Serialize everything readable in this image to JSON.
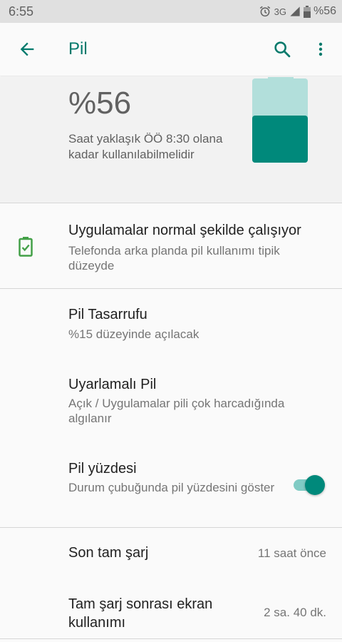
{
  "status_bar": {
    "time": "6:55",
    "network": "3G",
    "battery_text": "%56",
    "icons": [
      "alarm-icon",
      "signal-icon",
      "battery-icon"
    ]
  },
  "app_bar": {
    "title": "Pil",
    "icons": [
      "back-arrow-icon",
      "search-icon",
      "more-vert-icon"
    ]
  },
  "battery_header": {
    "percent": "%56",
    "estimate": "Saat yaklaşık ÖÖ 8:30 olana kadar kullanılabilmelidir",
    "level": 0.56
  },
  "tip": {
    "title": "Uygulamalar normal şekilde çalışıyor",
    "subtitle": "Telefonda arka planda pil kullanımı tipik düzeyde",
    "icon": "battery-ok-icon"
  },
  "settings": [
    {
      "title": "Pil Tasarrufu",
      "subtitle": "%15 düzeyinde açılacak"
    },
    {
      "title": "Uyarlamalı Pil",
      "subtitle": "Açık / Uygulamalar pili çok harcadığında algılanır"
    },
    {
      "title": "Pil yüzdesi",
      "subtitle": "Durum çubuğunda pil yüzdesini göster",
      "toggle_on": true
    }
  ],
  "usage": [
    {
      "title": "Son tam şarj",
      "value": "11 saat önce"
    },
    {
      "title": "Tam şarj sonrası ekran kullanımı",
      "value": "2 sa. 40 dk."
    }
  ],
  "colors": {
    "accent": "#00796b",
    "battery_fill": "#00897b",
    "battery_empty": "#b2dfdb",
    "tip_icon": "#43a047"
  }
}
